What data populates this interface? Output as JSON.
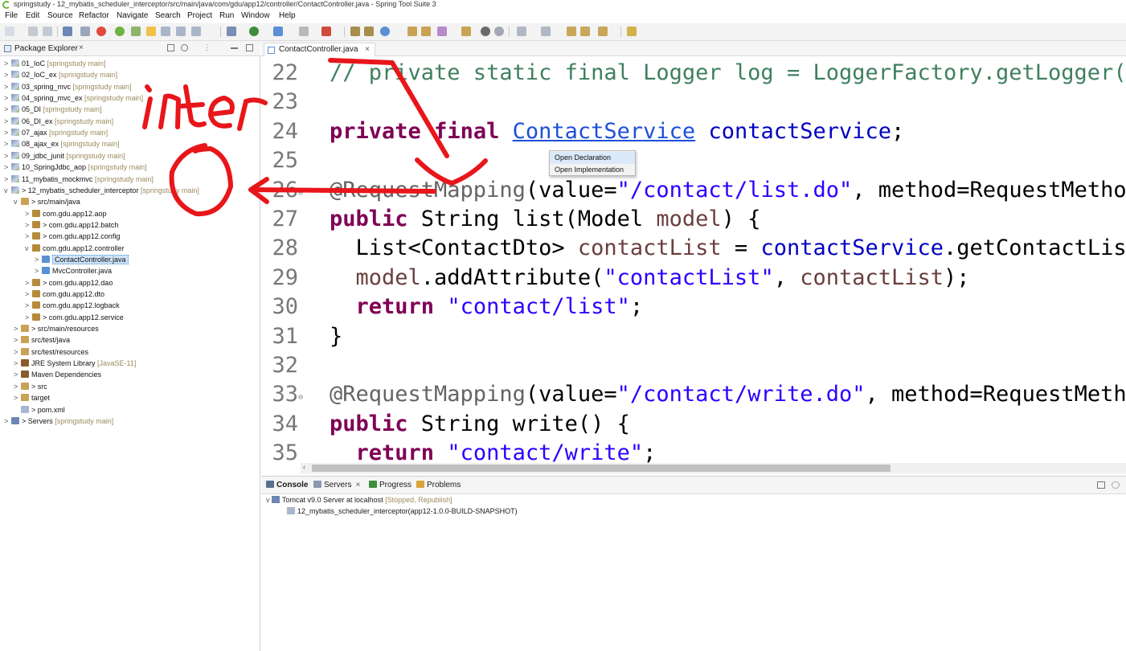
{
  "window": {
    "title": "springstudy - 12_mybatis_scheduler_interceptor/src/main/java/com/gdu/app12/controller/ContactController.java - Spring Tool Suite 3"
  },
  "menu": [
    "File",
    "Edit",
    "Source",
    "Refactor",
    "Navigate",
    "Search",
    "Project",
    "Run",
    "Window",
    "Help"
  ],
  "explorer": {
    "title": "Package Explorer",
    "items": [
      {
        "arrow": ">",
        "icon": "project",
        "label": "01_IoC",
        "deco": " [springstudy main]"
      },
      {
        "arrow": ">",
        "icon": "project",
        "label": "02_IoC_ex",
        "deco": " [springstudy main]"
      },
      {
        "arrow": ">",
        "icon": "project",
        "label": "03_spring_mvc",
        "deco": " [springstudy main]"
      },
      {
        "arrow": ">",
        "icon": "project",
        "label": "04_spring_mvc_ex",
        "deco": " [springstudy main]"
      },
      {
        "arrow": ">",
        "icon": "project",
        "label": "05_DI",
        "deco": " [springstudy main]"
      },
      {
        "arrow": ">",
        "icon": "project",
        "label": "06_DI_ex",
        "deco": " [springstudy main]"
      },
      {
        "arrow": ">",
        "icon": "project",
        "label": "07_ajax",
        "deco": " [springstudy main]"
      },
      {
        "arrow": ">",
        "icon": "project",
        "label": "08_ajax_ex",
        "deco": " [springstudy main]"
      },
      {
        "arrow": ">",
        "icon": "project",
        "label": "09_jdbc_junit",
        "deco": " [springstudy main]"
      },
      {
        "arrow": ">",
        "icon": "project",
        "label": "10_SpringJdbc_aop",
        "deco": " [springstudy main]"
      },
      {
        "arrow": ">",
        "icon": "project",
        "label": "11_mybatis_mockmvc",
        "deco": " [springstudy main]"
      },
      {
        "arrow": "v",
        "icon": "project",
        "label": "> 12_mybatis_scheduler_interceptor",
        "deco": " [springstudy main]"
      },
      {
        "arrow": "v",
        "icon": "folder",
        "label": "> src/main/java",
        "deco": ""
      },
      {
        "arrow": ">",
        "icon": "package",
        "label": "com.gdu.app12.aop",
        "deco": ""
      },
      {
        "arrow": ">",
        "icon": "package",
        "label": "> com.gdu.app12.batch",
        "deco": ""
      },
      {
        "arrow": ">",
        "icon": "package",
        "label": "> com.gdu.app12.config",
        "deco": ""
      },
      {
        "arrow": "v",
        "icon": "package",
        "label": "com.gdu.app12.controller",
        "deco": ""
      },
      {
        "arrow": ">",
        "icon": "java",
        "label": "ContactController.java",
        "deco": ""
      },
      {
        "arrow": ">",
        "icon": "java",
        "label": "MvcController.java",
        "deco": ""
      },
      {
        "arrow": ">",
        "icon": "package",
        "label": "> com.gdu.app12.dao",
        "deco": ""
      },
      {
        "arrow": ">",
        "icon": "package",
        "label": "com.gdu.app12.dto",
        "deco": ""
      },
      {
        "arrow": ">",
        "icon": "package",
        "label": "com.gdu.app12.logback",
        "deco": ""
      },
      {
        "arrow": ">",
        "icon": "package",
        "label": "> com.gdu.app12.service",
        "deco": ""
      },
      {
        "arrow": ">",
        "icon": "folder",
        "label": "> src/main/resources",
        "deco": ""
      },
      {
        "arrow": ">",
        "icon": "folder",
        "label": "src/test/java",
        "deco": ""
      },
      {
        "arrow": ">",
        "icon": "folder",
        "label": "src/test/resources",
        "deco": ""
      },
      {
        "arrow": ">",
        "icon": "lib",
        "label": "JRE System Library",
        "deco": " [JavaSE-11]"
      },
      {
        "arrow": ">",
        "icon": "lib",
        "label": "Maven Dependencies",
        "deco": ""
      },
      {
        "arrow": ">",
        "icon": "folder",
        "label": "> src",
        "deco": ""
      },
      {
        "arrow": ">",
        "icon": "folder",
        "label": "target",
        "deco": ""
      },
      {
        "arrow": "",
        "icon": "xml",
        "label": "> pom.xml",
        "deco": ""
      },
      {
        "arrow": ">",
        "icon": "server",
        "label": "> Servers",
        "deco": " [springstudy main]"
      }
    ]
  },
  "editor": {
    "tab_label": "ContactController.java",
    "lines": [
      {
        "n": "22",
        "fold": "",
        "html": "<span class=\"cmt\">// private static final Logger log = LoggerFactory.getLogger(Co</span>"
      },
      {
        "n": "23",
        "fold": "",
        "html": ""
      },
      {
        "n": "24",
        "fold": "",
        "html": "<span class=\"kw\">private</span> <span class=\"kw\">final</span> <span class=\"link\">ContactService</span> <span class=\"fld\">contactService</span>;"
      },
      {
        "n": "25",
        "fold": "",
        "html": ""
      },
      {
        "n": "26",
        "fold": "⊖",
        "html": "<span class=\"ann\">@RequestMapping</span>(value=<span class=\"str\">\"/contact/list.do\"</span>, method=RequestMethod."
      },
      {
        "n": "27",
        "fold": "",
        "html": "<span class=\"kw\">public</span> String list(Model <span class=\"var\">model</span>) {"
      },
      {
        "n": "28",
        "fold": "",
        "html": "  List&lt;ContactDto&gt; <span class=\"var\">contactList</span> = <span class=\"fld\">contactService</span>.getContactList("
      },
      {
        "n": "29",
        "fold": "",
        "html": "  <span class=\"var\">model</span>.addAttribute(<span class=\"str\">\"contactList\"</span>, <span class=\"var\">contactList</span>);"
      },
      {
        "n": "30",
        "fold": "",
        "html": "  <span class=\"kw\">return</span> <span class=\"str\">\"contact/list\"</span>;"
      },
      {
        "n": "31",
        "fold": "",
        "html": "}"
      },
      {
        "n": "32",
        "fold": "",
        "html": ""
      },
      {
        "n": "33",
        "fold": "⊖",
        "html": "<span class=\"ann\">@RequestMapping</span>(value=<span class=\"str\">\"/contact/write.do\"</span>, method=RequestMethod"
      },
      {
        "n": "34",
        "fold": "",
        "html": "<span class=\"kw\">public</span> String write() {"
      },
      {
        "n": "35",
        "fold": "",
        "html": "  <span class=\"kw\">return</span> <span class=\"str\">\"contact/write\"</span>;"
      }
    ]
  },
  "context_menu": {
    "items": [
      "Open Declaration",
      "Open Implementation"
    ]
  },
  "console": {
    "tabs": [
      "Console",
      "Servers",
      "Progress",
      "Problems"
    ],
    "server_label": "Tomcat v9.0 Server at localhost",
    "server_status": "[Stopped, Republish]",
    "module_label": "12_mybatis_scheduler_interceptor(app12-1.0.0-BUILD-SNAPSHOT)"
  },
  "annotation": {
    "text": "inter",
    "color": "#e8161b"
  }
}
